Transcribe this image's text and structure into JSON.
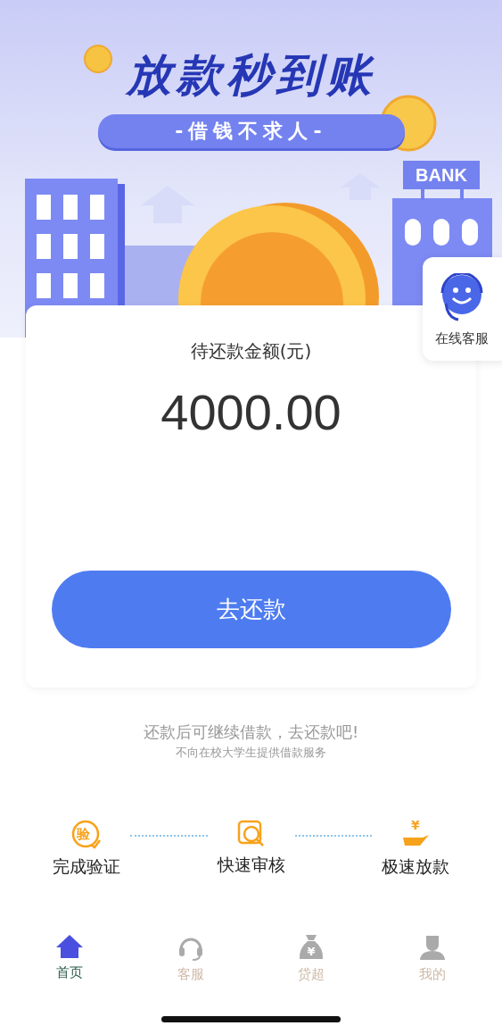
{
  "banner": {
    "title": "放款秒到账",
    "slogan": "-借钱不求人-",
    "bank_sign": "BANK"
  },
  "service_widget": {
    "label": "在线客服"
  },
  "card": {
    "label": "待还款金额(元)",
    "amount": "4000.00",
    "button": "去还款"
  },
  "notes": [
    "还款后可继续借款，去还款吧!",
    "不向在校大学生提供借款服务"
  ],
  "steps": [
    {
      "label": "完成验证",
      "kind": "verify",
      "icon_text": "验"
    },
    {
      "label": "快速审核",
      "kind": "review"
    },
    {
      "label": "极速放款",
      "kind": "payout",
      "icon_text": "¥"
    }
  ],
  "tabs": [
    {
      "label": "首页",
      "kind": "home",
      "selected": true
    },
    {
      "label": "客服",
      "kind": "headset",
      "selected": false
    },
    {
      "label": "贷超",
      "kind": "moneybag",
      "selected": false,
      "icon_text": "¥"
    },
    {
      "label": "我的",
      "kind": "person",
      "selected": false
    }
  ]
}
